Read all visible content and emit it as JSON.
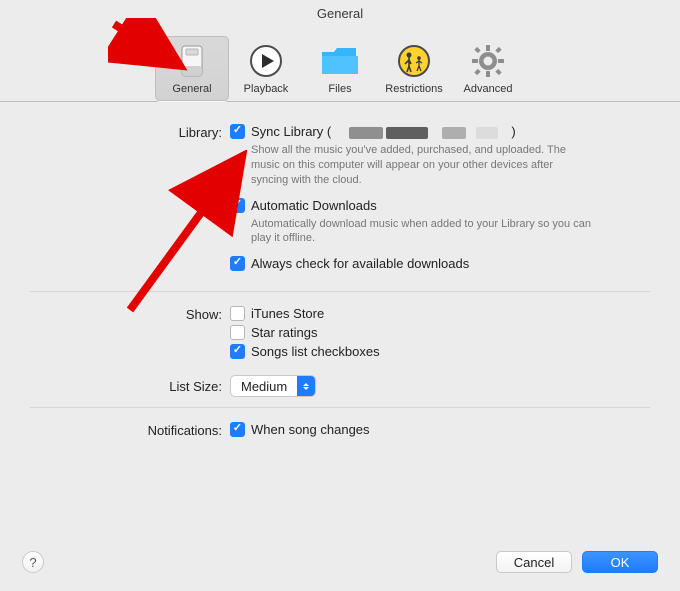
{
  "title": "General",
  "tabs": {
    "general": "General",
    "playback": "Playback",
    "files": "Files",
    "restrictions": "Restrictions",
    "advanced": "Advanced"
  },
  "sections": {
    "library_label": "Library:",
    "show_label": "Show:",
    "list_size_label": "List Size:",
    "notifications_label": "Notifications:"
  },
  "library": {
    "sync_label_prefix": "Sync Library (",
    "sync_label_suffix": ")",
    "sync_desc": "Show all the music you've added, purchased, and uploaded. The music on this computer will appear on your other devices after syncing with the cloud.",
    "auto_dl_label": "Automatic Downloads",
    "auto_dl_desc": "Automatically download music when added to your Library so you can play it offline.",
    "always_check_label": "Always check for available downloads"
  },
  "show": {
    "itunes_store": "iTunes Store",
    "star_ratings": "Star ratings",
    "songs_checkboxes": "Songs list checkboxes"
  },
  "list_size": {
    "value": "Medium"
  },
  "notifications": {
    "song_changes": "When song changes"
  },
  "footer": {
    "help_tooltip": "?",
    "cancel": "Cancel",
    "ok": "OK"
  }
}
